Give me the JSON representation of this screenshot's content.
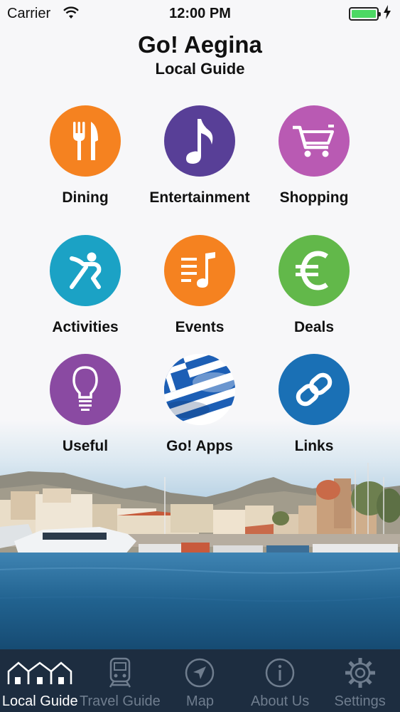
{
  "status_bar": {
    "carrier": "Carrier",
    "time": "12:00 PM",
    "battery_level": 1.0
  },
  "header": {
    "title": "Go! Aegina",
    "subtitle": "Local Guide"
  },
  "categories": [
    {
      "label": "Dining",
      "icon": "fork-knife-icon",
      "color": "#f58220"
    },
    {
      "label": "Entertainment",
      "icon": "music-note-icon",
      "color": "#583f97"
    },
    {
      "label": "Shopping",
      "icon": "shopping-cart-icon",
      "color": "#b95ab3"
    },
    {
      "label": "Activities",
      "icon": "stretching-person-icon",
      "color": "#1ba2c5"
    },
    {
      "label": "Events",
      "icon": "music-list-icon",
      "color": "#f58220"
    },
    {
      "label": "Deals",
      "icon": "euro-icon",
      "color": "#62b84a"
    },
    {
      "label": "Useful",
      "icon": "lightbulb-icon",
      "color": "#8a4aa2"
    },
    {
      "label": "Go! Apps",
      "icon": "greek-flag-icon",
      "color": "#1d5fb5"
    },
    {
      "label": "Links",
      "icon": "chain-link-icon",
      "color": "#1a70b5"
    }
  ],
  "tabs": [
    {
      "label": "Local Guide",
      "icon": "houses-icon",
      "active": true
    },
    {
      "label": "Travel Guide",
      "icon": "train-icon",
      "active": false
    },
    {
      "label": "Map",
      "icon": "navigation-arrow-icon",
      "active": false
    },
    {
      "label": "About Us",
      "icon": "info-icon",
      "active": false
    },
    {
      "label": "Settings",
      "icon": "gear-icon",
      "active": false
    }
  ],
  "colors": {
    "tab_bar_bg": "#1d2d40",
    "tab_active": "#ffffff",
    "tab_inactive": "#6f7d8e",
    "battery": "#4cd964"
  }
}
